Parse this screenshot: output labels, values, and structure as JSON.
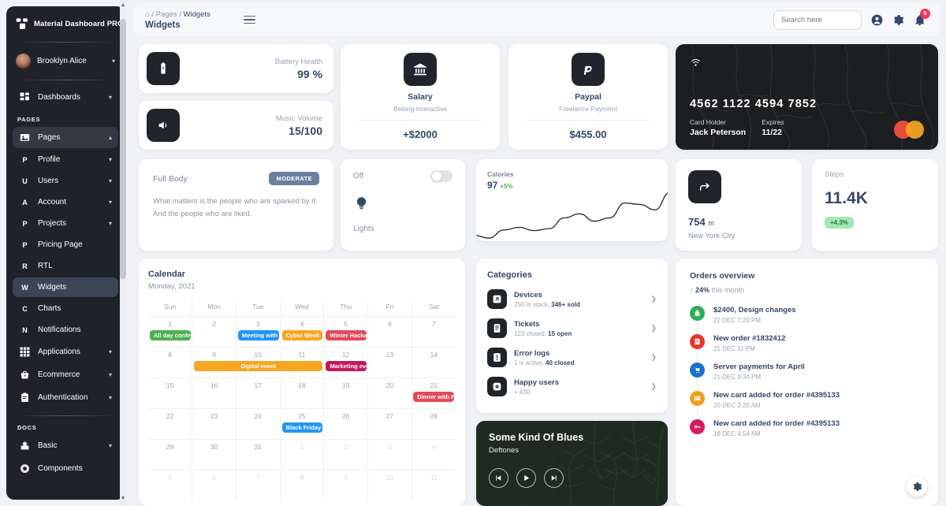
{
  "sidebar": {
    "brand": "Material Dashboard PRO",
    "user": "Brooklyn Alice",
    "dashboards": "Dashboards",
    "section_pages": "PAGES",
    "section_docs": "DOCS",
    "items": [
      {
        "label": "Pages",
        "icon": "image-icon",
        "letter": "",
        "chevron": "up",
        "state": "open"
      },
      {
        "label": "Profile",
        "icon": "",
        "letter": "P",
        "chevron": "down",
        "state": ""
      },
      {
        "label": "Users",
        "icon": "",
        "letter": "U",
        "chevron": "down",
        "state": ""
      },
      {
        "label": "Account",
        "icon": "",
        "letter": "A",
        "chevron": "down",
        "state": ""
      },
      {
        "label": "Projects",
        "icon": "",
        "letter": "P",
        "chevron": "down",
        "state": ""
      },
      {
        "label": "Pricing Page",
        "icon": "",
        "letter": "P",
        "chevron": "",
        "state": ""
      },
      {
        "label": "RTL",
        "icon": "",
        "letter": "R",
        "chevron": "",
        "state": ""
      },
      {
        "label": "Widgets",
        "icon": "",
        "letter": "W",
        "chevron": "",
        "state": "active"
      },
      {
        "label": "Charts",
        "icon": "",
        "letter": "C",
        "chevron": "",
        "state": ""
      },
      {
        "label": "Notifications",
        "icon": "",
        "letter": "N",
        "chevron": "",
        "state": ""
      },
      {
        "label": "Applications",
        "icon": "grid-icon",
        "letter": "",
        "chevron": "down",
        "state": ""
      },
      {
        "label": "Ecommerce",
        "icon": "basket-icon",
        "letter": "",
        "chevron": "down",
        "state": ""
      },
      {
        "label": "Authentication",
        "icon": "clipboard-icon",
        "letter": "",
        "chevron": "down",
        "state": ""
      }
    ],
    "docs_items": [
      {
        "label": "Basic",
        "icon": "spark-box-icon",
        "chevron": "down"
      },
      {
        "label": "Components",
        "icon": "components-icon",
        "chevron": ""
      }
    ]
  },
  "topbar": {
    "breadcrumb_home": "home-icon",
    "breadcrumb_parent": "Pages",
    "breadcrumb_current": "Widgets",
    "page_title": "Widgets",
    "search_placeholder": "Search here",
    "search_value": "",
    "notification_count": "9"
  },
  "stats": {
    "battery": {
      "label": "Battery Health",
      "value": "99 %",
      "icon": "battery-icon"
    },
    "music": {
      "label": "Music Volume",
      "value": "15/100",
      "icon": "volume-icon"
    }
  },
  "payments": [
    {
      "title": "Salary",
      "subtitle": "Belong Interactive",
      "amount": "+$2000",
      "icon": "bank-icon"
    },
    {
      "title": "Paypal",
      "subtitle": "Freelance Payment",
      "amount": "$455.00",
      "icon": "paypal-icon"
    }
  ],
  "credit_card": {
    "number": "4562  1122  4594  7852",
    "holder_label": "Card Holder",
    "holder_value": "Jack Peterson",
    "expires_label": "Expires",
    "expires_value": "11/22",
    "wifi_icon": "contactless-icon",
    "brand_icon": "mastercard-icon"
  },
  "full_body": {
    "title": "Full Body",
    "badge": "MODERATE",
    "text": "What matters is the people who are sparked by it. And the people who are liked."
  },
  "lights": {
    "state_label": "Off",
    "label": "Lights",
    "toggle_on": false,
    "icon": "bulb-icon"
  },
  "distance": {
    "value": "754",
    "unit": "m",
    "city": "New York City",
    "icon": "direction-icon"
  },
  "steps": {
    "label": "Steps",
    "value": "11.4K",
    "badge": "+4.3%"
  },
  "calendar": {
    "title": "Calendar",
    "subtitle": "Monday, 2021",
    "weekdays": [
      "Sun",
      "Mon",
      "Tue",
      "Wed",
      "Thu",
      "Fri",
      "Sat"
    ],
    "weeks": [
      [
        {
          "d": "1",
          "muted": false
        },
        {
          "d": "2",
          "muted": false
        },
        {
          "d": "3",
          "muted": false
        },
        {
          "d": "4",
          "muted": false
        },
        {
          "d": "5",
          "muted": false
        },
        {
          "d": "6",
          "muted": false
        },
        {
          "d": "7",
          "muted": false
        }
      ],
      [
        {
          "d": "8",
          "muted": false
        },
        {
          "d": "9",
          "muted": false
        },
        {
          "d": "10",
          "muted": false
        },
        {
          "d": "11",
          "muted": false
        },
        {
          "d": "12",
          "muted": false
        },
        {
          "d": "13",
          "muted": false
        },
        {
          "d": "14",
          "muted": false
        }
      ],
      [
        {
          "d": "15",
          "muted": false
        },
        {
          "d": "16",
          "muted": false
        },
        {
          "d": "17",
          "muted": false
        },
        {
          "d": "18",
          "muted": false
        },
        {
          "d": "19",
          "muted": false
        },
        {
          "d": "20",
          "muted": false
        },
        {
          "d": "21",
          "muted": false
        }
      ],
      [
        {
          "d": "22",
          "muted": false
        },
        {
          "d": "23",
          "muted": false
        },
        {
          "d": "24",
          "muted": false
        },
        {
          "d": "25",
          "muted": false
        },
        {
          "d": "26",
          "muted": false
        },
        {
          "d": "27",
          "muted": false
        },
        {
          "d": "28",
          "muted": false
        }
      ],
      [
        {
          "d": "29",
          "muted": false
        },
        {
          "d": "30",
          "muted": false
        },
        {
          "d": "31",
          "muted": false
        },
        {
          "d": "1",
          "muted": true
        },
        {
          "d": "2",
          "muted": true
        },
        {
          "d": "3",
          "muted": true
        },
        {
          "d": "4",
          "muted": true
        }
      ],
      [
        {
          "d": "5",
          "muted": true
        },
        {
          "d": "6",
          "muted": true
        },
        {
          "d": "7",
          "muted": true
        },
        {
          "d": "8",
          "muted": true
        },
        {
          "d": "9",
          "muted": true
        },
        {
          "d": "10",
          "muted": true
        },
        {
          "d": "11",
          "muted": true
        }
      ]
    ],
    "events": [
      {
        "label": "All day conference",
        "color": "#4caf50",
        "week": 0,
        "day": 0,
        "span": 1
      },
      {
        "label": "Meeting with Mary",
        "color": "#2196f3",
        "week": 0,
        "day": 2,
        "span": 1
      },
      {
        "label": "Cyber Week",
        "color": "#f5a623",
        "week": 0,
        "day": 3,
        "span": 1
      },
      {
        "label": "Winter Hackaton",
        "color": "#e14b5a",
        "week": 0,
        "day": 4,
        "span": 1
      },
      {
        "label": "Digital event",
        "color": "#f5a623",
        "week": 1,
        "day": 1,
        "span": 3
      },
      {
        "label": "Marketing event",
        "color": "#c2185b",
        "week": 1,
        "day": 4,
        "span": 1
      },
      {
        "label": "Dinner with Family",
        "color": "#e14b5a",
        "week": 2,
        "day": 6,
        "span": 1
      },
      {
        "label": "Black Friday",
        "color": "#2196f3",
        "week": 3,
        "day": 3,
        "span": 1
      }
    ]
  },
  "categories": {
    "title": "Categories",
    "items": [
      {
        "name": "Devices",
        "sub_plain": "250 in stock, ",
        "sub_bold": "346+ sold",
        "icon": "devices-icon"
      },
      {
        "name": "Tickets",
        "sub_plain": "123 closed, ",
        "sub_bold": "15 open",
        "icon": "ticket-icon"
      },
      {
        "name": "Error logs",
        "sub_plain": "1 is active, ",
        "sub_bold": "40 closed",
        "icon": "alert-icon"
      },
      {
        "name": "Happy users",
        "sub_plain": "+ 430",
        "sub_bold": "",
        "icon": "user-circle-icon"
      }
    ],
    "arrow": "chevron-right-icon"
  },
  "player": {
    "title": "Some Kind Of Blues",
    "artist": "Deftones",
    "prev": "previous-icon",
    "play": "play-icon",
    "next": "next-icon"
  },
  "orders": {
    "title": "Orders overview",
    "growth_arrow": "arrow-up-icon",
    "growth": "24%",
    "growth_suffix": " this month",
    "items": [
      {
        "text": "$2400, Design changes",
        "time": "22 DEC 7:20 PM",
        "color": "#2dae56",
        "icon": "bell-icon"
      },
      {
        "text": "New order #1832412",
        "time": "21 DEC 11 PM",
        "color": "#e8352c",
        "icon": "document-icon"
      },
      {
        "text": "Server payments for April",
        "time": "21 DEC 9:34 PM",
        "color": "#1a6fd4",
        "icon": "cart-icon"
      },
      {
        "text": "New card added for order #4395133",
        "time": "20 DEC 2:20 AM",
        "color": "#f0a020",
        "icon": "card-icon"
      },
      {
        "text": "New card added for order #4395133",
        "time": "18 DEC 4:54 AM",
        "color": "#d81b60",
        "icon": "key-icon"
      }
    ],
    "settings_icon": "gear-icon"
  },
  "chart_data": {
    "type": "line",
    "title": "Calories",
    "value": "97",
    "delta": "+5%",
    "x": [
      0,
      1,
      2,
      3,
      4,
      5,
      6,
      7,
      8,
      9,
      10,
      11,
      12
    ],
    "values": [
      14,
      10,
      22,
      26,
      21,
      24,
      40,
      46,
      35,
      40,
      62,
      60,
      52,
      78
    ],
    "ylim": [
      0,
      100
    ],
    "grid": false,
    "legend": false,
    "xlabel": "",
    "ylabel": "",
    "line_color": "#2b3445"
  },
  "colors": {
    "accent": "#344767",
    "muted": "#9aa3b1",
    "success": "#4caf50",
    "danger": "#f5365c",
    "sidebar_bg": "#212229",
    "sidebar_active": "#3c4557"
  }
}
